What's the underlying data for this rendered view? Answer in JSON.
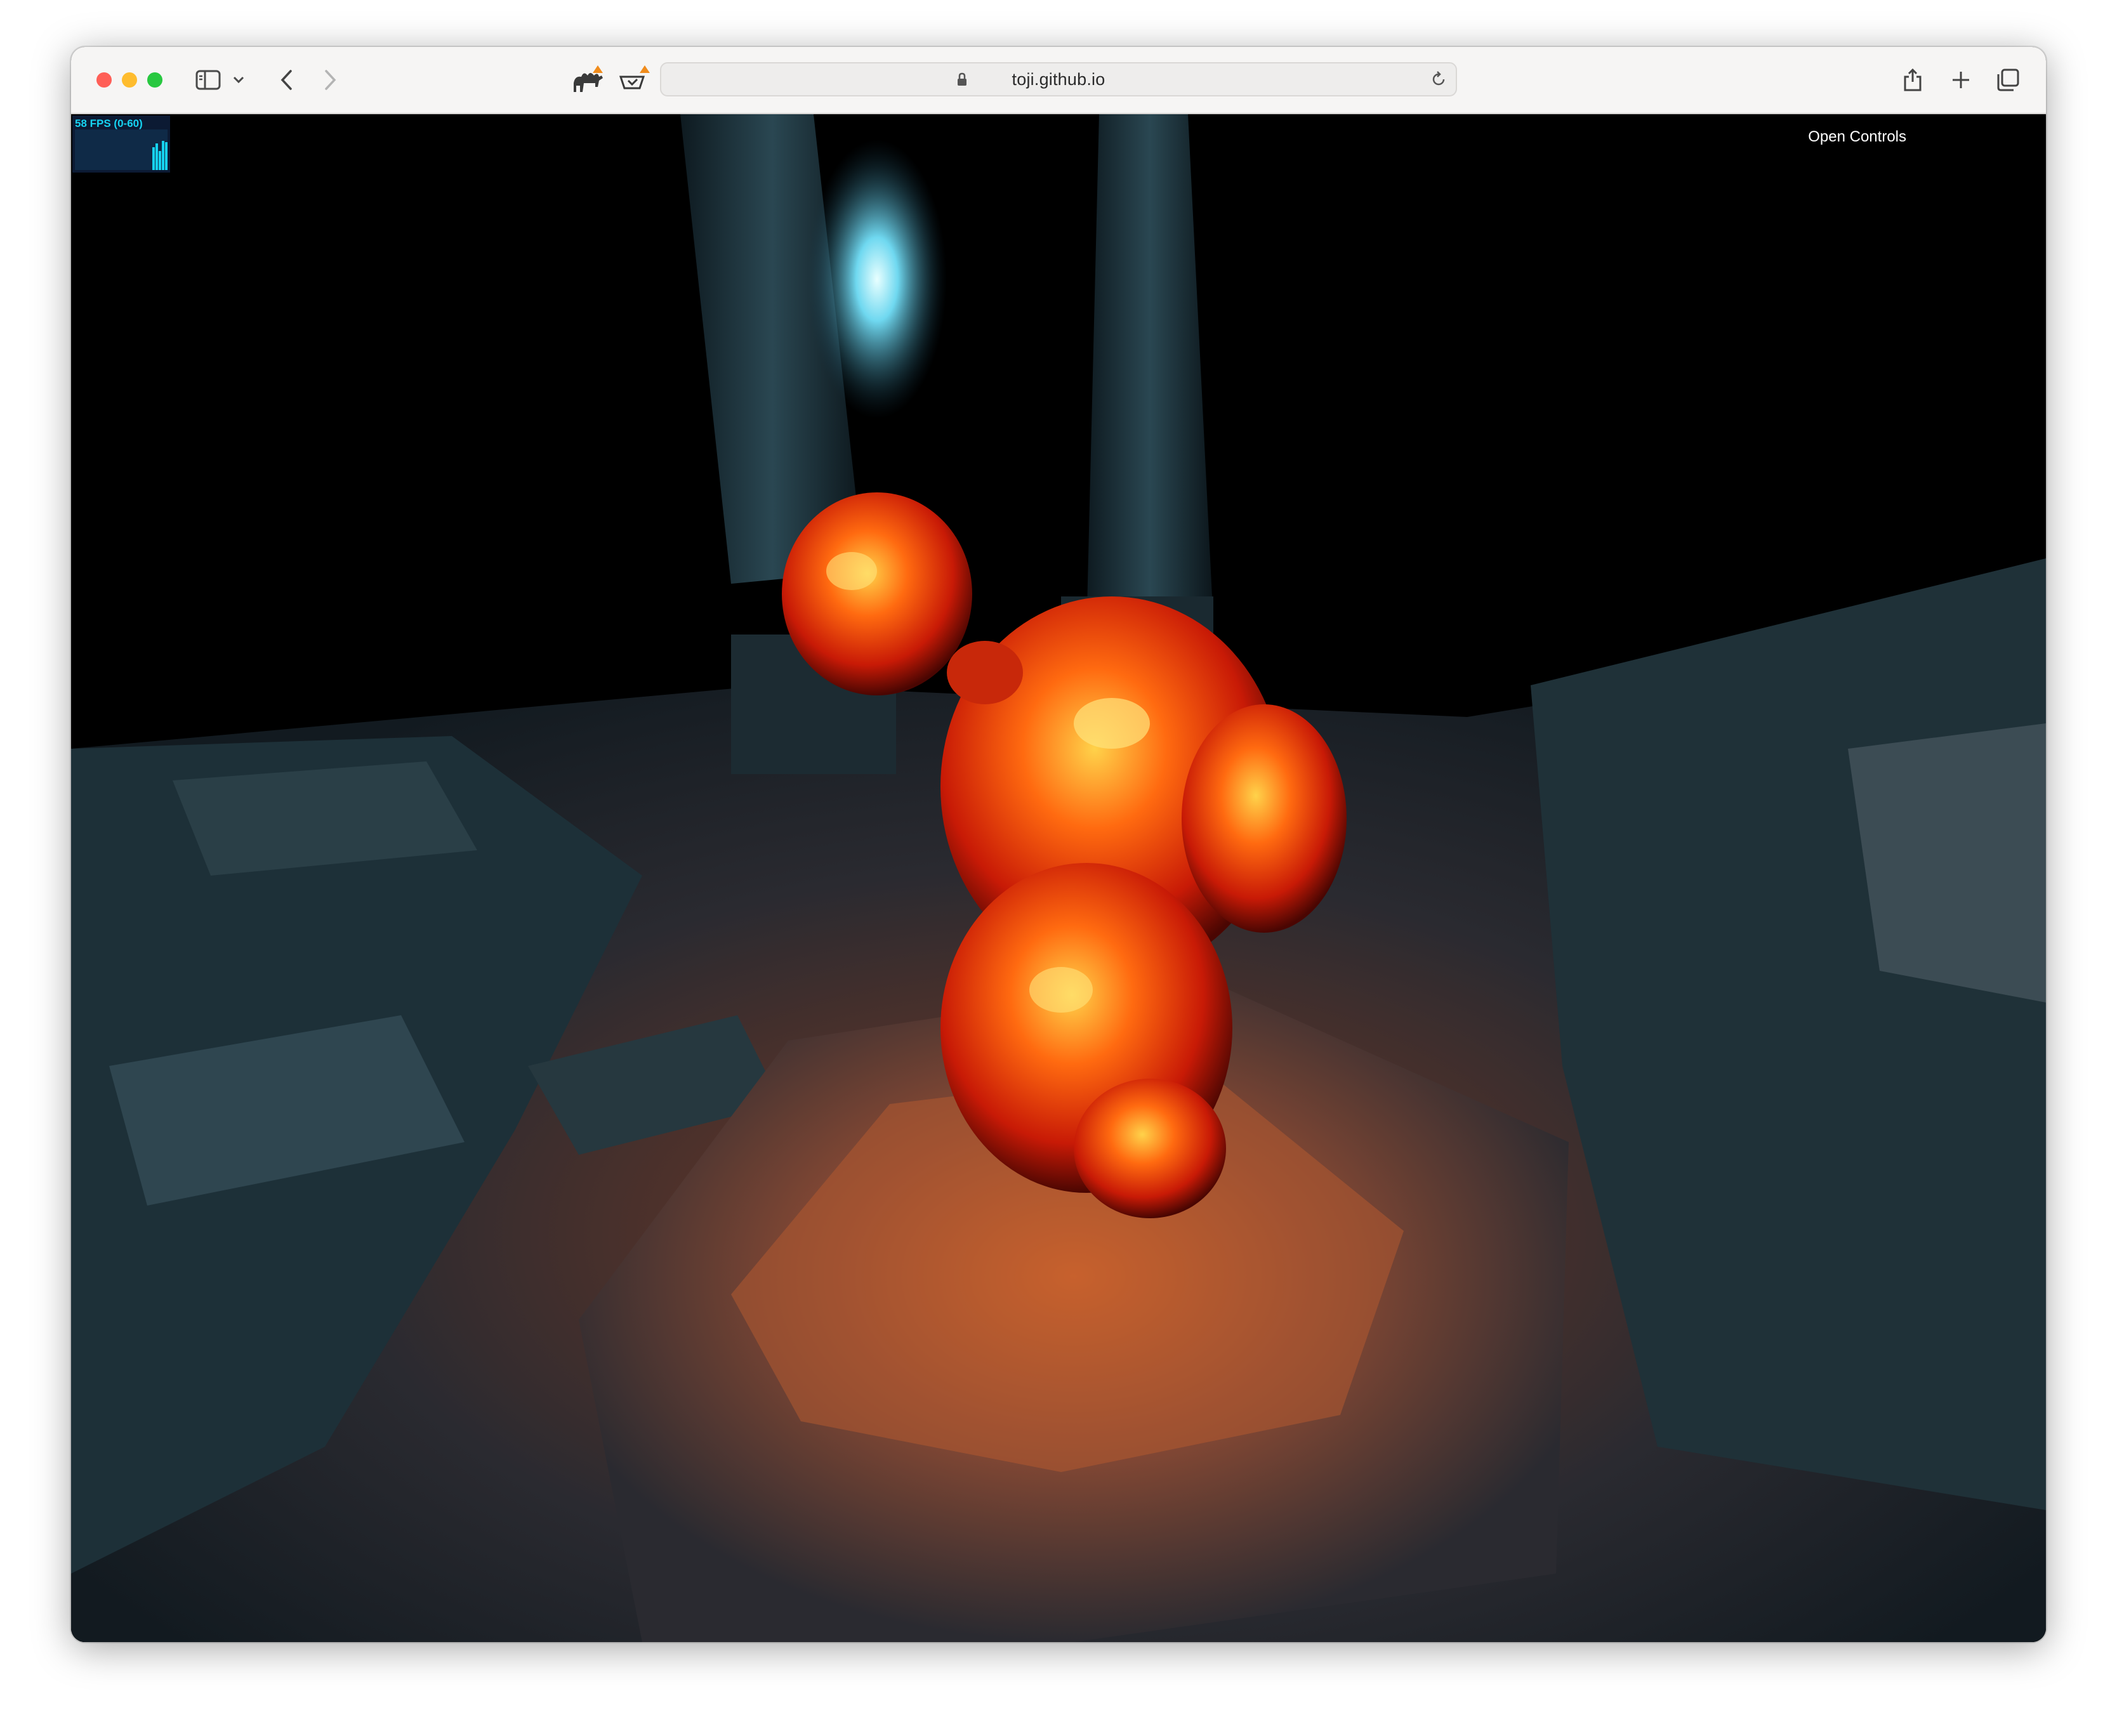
{
  "browser": {
    "url": "toji.github.io",
    "colors": {
      "close": "#ff5f57",
      "minimize": "#febc2e",
      "zoom": "#28c840",
      "warning": "#f08c1c"
    },
    "icons": [
      "sidebar-icon",
      "chevron-down-icon",
      "back-icon",
      "forward-icon",
      "camel-extension-icon",
      "translate-extension-icon",
      "lock-icon",
      "reload-icon",
      "share-icon",
      "new-tab-icon",
      "tab-overview-icon"
    ]
  },
  "page": {
    "fps_counter": "58 FPS (0-60)",
    "fps_value": 58,
    "fps_range": [
      0,
      60
    ],
    "controls_link": "Open Controls"
  }
}
